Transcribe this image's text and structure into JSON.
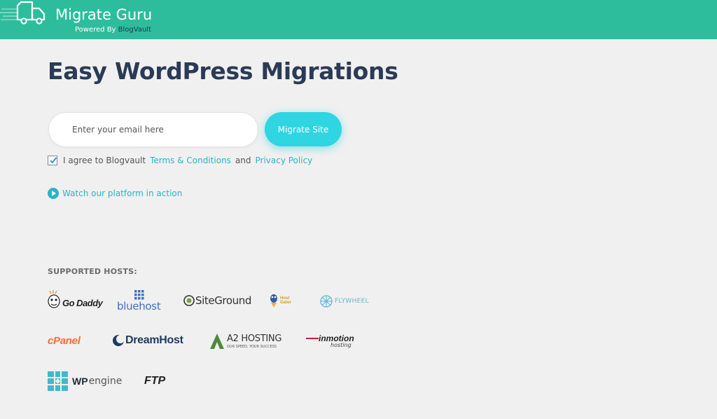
{
  "header": {
    "title": "Migrate Guru",
    "powered_prefix": "Powered By ",
    "powered_brand": "BlogVault",
    "bg_color": "#2ebd9c"
  },
  "main": {
    "headline": "Easy WordPress Migrations",
    "email_placeholder": "Enter your email here",
    "migrate_button": "Migrate Site",
    "agree": {
      "checked": true,
      "text": "I agree to Blogvault",
      "terms_link": "Terms & Conditions",
      "and": "and",
      "privacy_link": "Privacy Policy"
    },
    "watch_link": "Watch our platform in action",
    "accent_color": "#2ab3c9"
  },
  "hosts": {
    "title": "SUPPORTED HOSTS:",
    "items": [
      {
        "name": "Go Daddy"
      },
      {
        "name": "bluehost"
      },
      {
        "name": "SiteGround"
      },
      {
        "name": "Host Gator"
      },
      {
        "name": "FLYWHEEL"
      },
      {
        "name": "cPanel"
      },
      {
        "name": "DreamHost"
      },
      {
        "name": "A2 HOSTING",
        "tagline": "OUR SPEED, YOUR SUCCESS"
      },
      {
        "name": "inmotion",
        "tagline": "hosting"
      },
      {
        "name": "WP",
        "name_rest": "engine"
      },
      {
        "name": "FTP"
      }
    ]
  }
}
